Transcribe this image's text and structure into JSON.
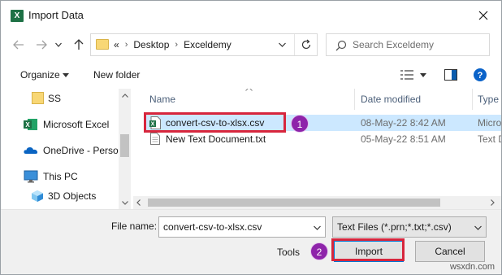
{
  "window": {
    "title": "Import Data",
    "app_icon_letter": "X"
  },
  "address_bar": {
    "overflow": "«",
    "crumbs": [
      "Desktop",
      "Exceldemy"
    ]
  },
  "search": {
    "placeholder": "Search Exceldemy"
  },
  "toolbar": {
    "organize_label": "Organize",
    "new_folder_label": "New folder"
  },
  "nav_pane": {
    "items": [
      {
        "label": "SS",
        "icon": "folder-icon"
      },
      {
        "label": "Microsoft Excel",
        "icon": "excel-icon"
      },
      {
        "label": "OneDrive - Person",
        "icon": "onedrive-icon"
      },
      {
        "label": "This PC",
        "icon": "monitor-icon"
      },
      {
        "label": "3D Objects",
        "icon": "cube-icon"
      }
    ]
  },
  "file_list": {
    "columns": {
      "name": "Name",
      "date_modified": "Date modified",
      "type": "Type"
    },
    "rows": [
      {
        "name": "convert-csv-to-xlsx.csv",
        "date": "08-May-22 8:42 AM",
        "type": "Micro",
        "icon": "excel-csv-icon",
        "selected": true
      },
      {
        "name": "New Text Document.txt",
        "date": "05-May-22 8:51 AM",
        "type": "Text D",
        "icon": "text-file-icon",
        "selected": false
      }
    ]
  },
  "bottom": {
    "file_name_label": "File name:",
    "file_name_value": "convert-csv-to-xlsx.csv",
    "file_type_value": "Text Files (*.prn;*.txt;*.csv)",
    "tools_label": "Tools",
    "import_label": "Import",
    "cancel_label": "Cancel"
  },
  "annotations": {
    "step1": "1",
    "step2": "2",
    "highlight_color": "#d7263d",
    "badge_color": "#8e24aa"
  },
  "watermark": "wsxdn.com",
  "colors": {
    "selection": "#cce8ff",
    "excel_green": "#1e7145",
    "folder_yellow": "#f8d775"
  }
}
